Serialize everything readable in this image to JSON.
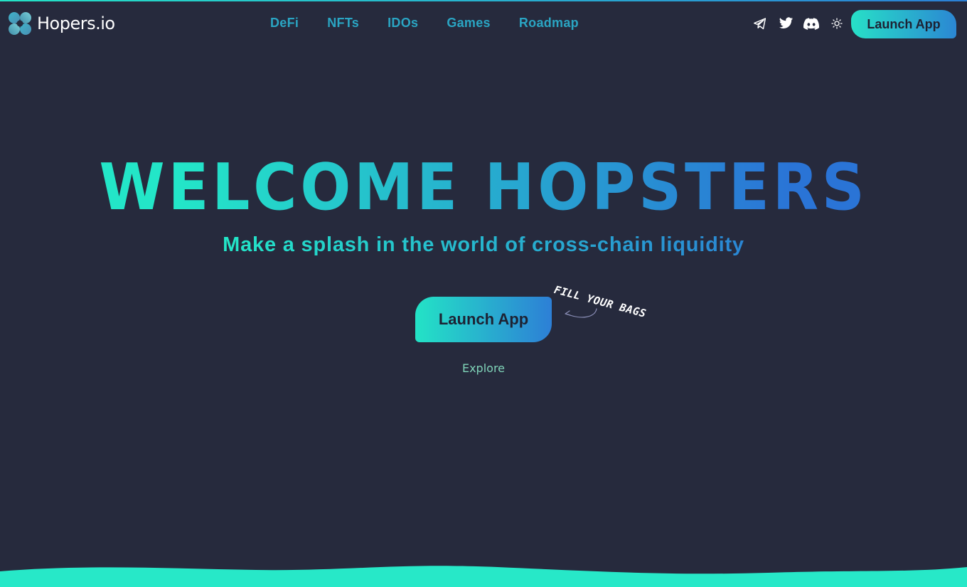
{
  "brand": {
    "name": "Hopers.io",
    "logo_icon": "clover-logo-icon"
  },
  "nav": {
    "items": [
      {
        "label": "DeFi"
      },
      {
        "label": "NFTs"
      },
      {
        "label": "IDOs"
      },
      {
        "label": "Games"
      },
      {
        "label": "Roadmap"
      }
    ]
  },
  "socials": [
    {
      "icon": "telegram-icon"
    },
    {
      "icon": "twitter-icon"
    },
    {
      "icon": "discord-icon"
    },
    {
      "icon": "sun-icon"
    }
  ],
  "header": {
    "launch_label": "Launch App"
  },
  "hero": {
    "title": "WELCOME HOPSTERS",
    "subtitle": "Make a splash in the world of cross-chain liquidity",
    "launch_label": "Launch App",
    "callout": "FILL YOUR BAGS",
    "explore_label": "Explore"
  },
  "colors": {
    "background": "#262a3d",
    "gradient_start": "#23e6c8",
    "gradient_end": "#2a74d6",
    "nav_text": "#2aa5c3",
    "explore_text": "#7fd3b8",
    "wave": "#27e8c8"
  }
}
